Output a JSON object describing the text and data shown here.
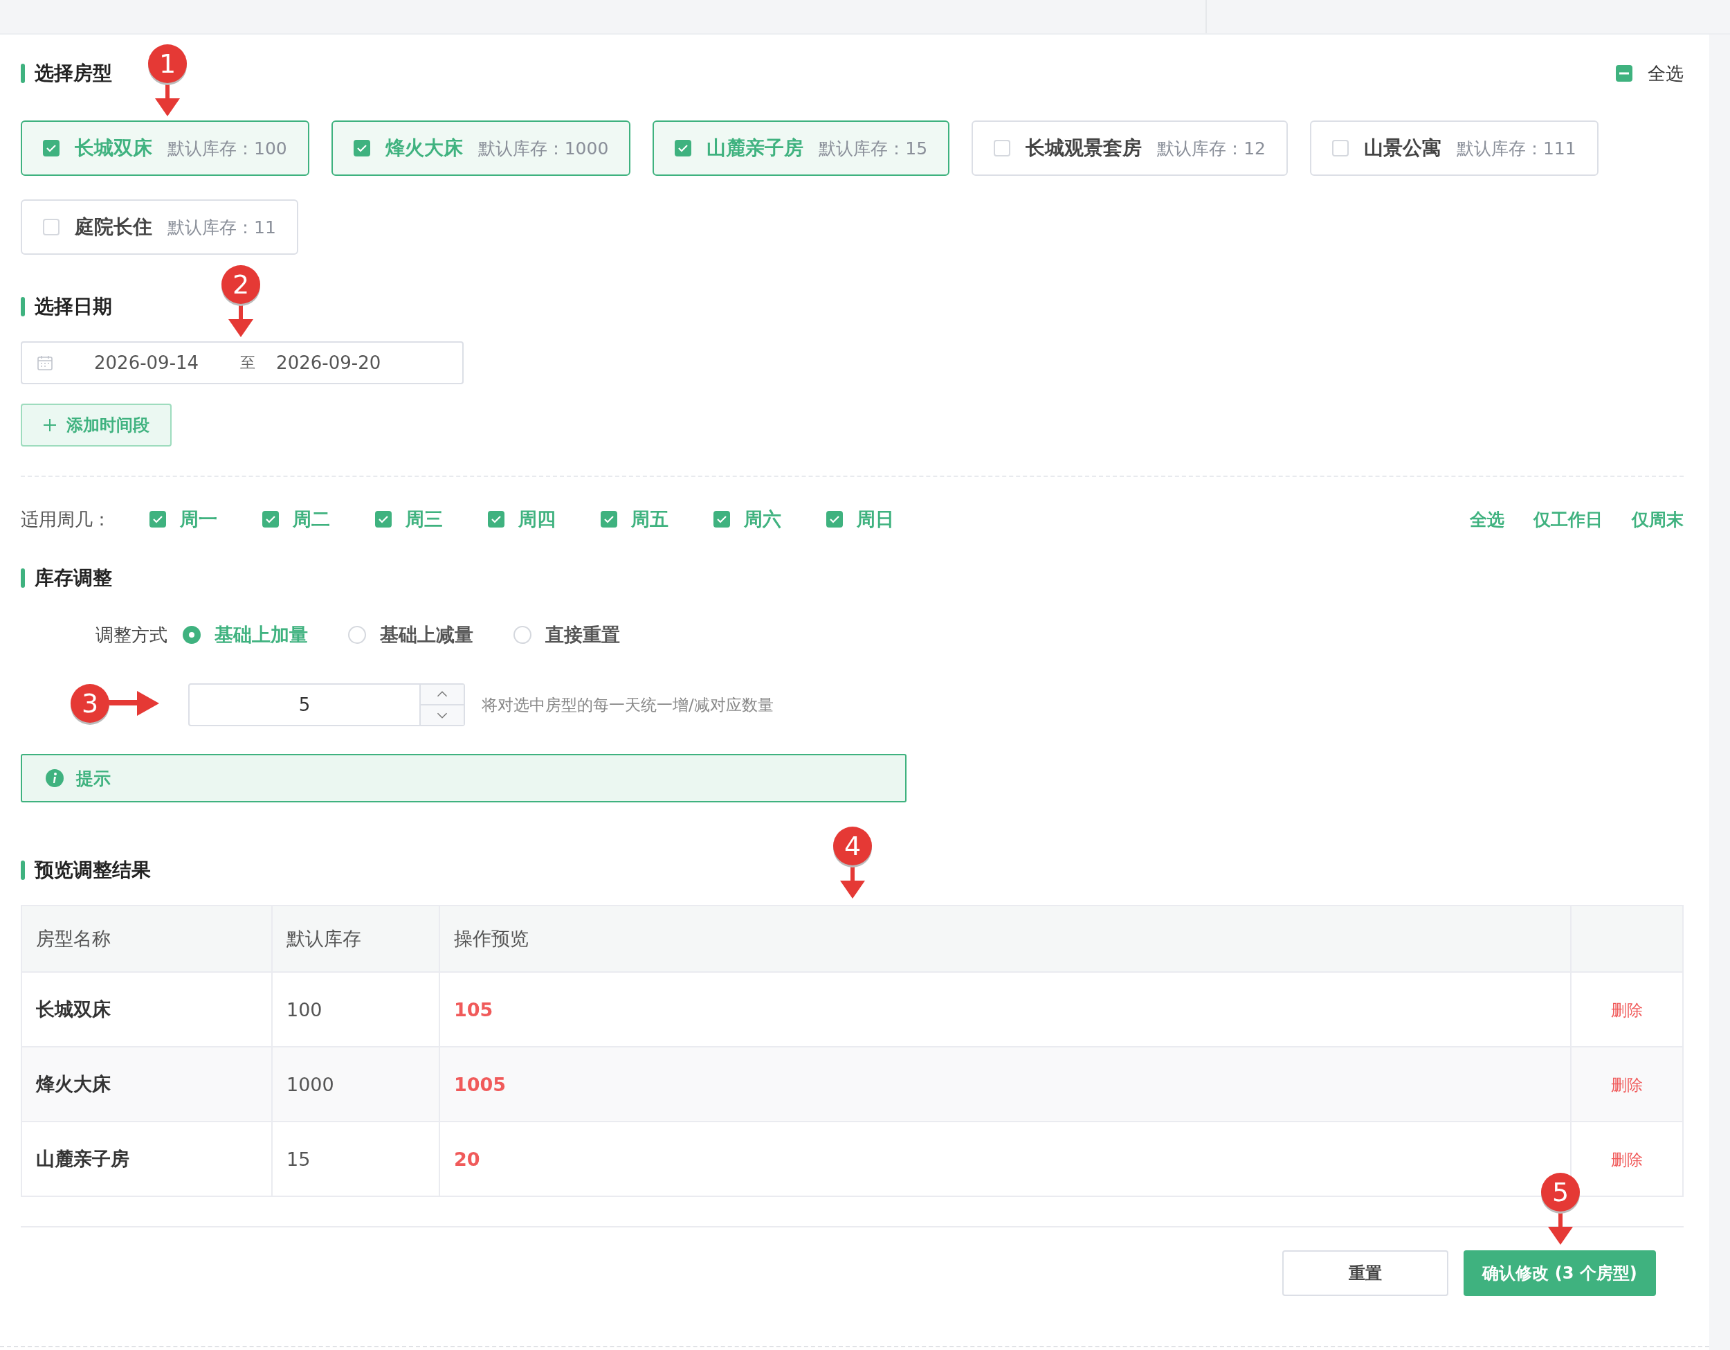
{
  "room_types": {
    "title": "选择房型",
    "select_all": {
      "label": "全选",
      "indeterminate": true
    },
    "rooms": [
      {
        "name": "长城双床",
        "stock_label": "默认库存：100",
        "checked": true
      },
      {
        "name": "烽火大床",
        "stock_label": "默认库存：1000",
        "checked": true
      },
      {
        "name": "山麓亲子房",
        "stock_label": "默认库存：15",
        "checked": true
      },
      {
        "name": "长城观景套房",
        "stock_label": "默认库存：12",
        "checked": false
      },
      {
        "name": "山景公寓",
        "stock_label": "默认库存：111",
        "checked": false
      },
      {
        "name": "庭院长住",
        "stock_label": "默认库存：11",
        "checked": false
      }
    ]
  },
  "date": {
    "title": "选择日期",
    "start": "2026-09-14",
    "separator": "至",
    "end": "2026-09-20",
    "add_button": "添加时间段"
  },
  "weekdays": {
    "label": "适用周几：",
    "days": [
      {
        "label": "周一",
        "checked": true
      },
      {
        "label": "周二",
        "checked": true
      },
      {
        "label": "周三",
        "checked": true
      },
      {
        "label": "周四",
        "checked": true
      },
      {
        "label": "周五",
        "checked": true
      },
      {
        "label": "周六",
        "checked": true
      },
      {
        "label": "周日",
        "checked": true
      }
    ],
    "shortcuts": [
      "全选",
      "仅工作日",
      "仅周末"
    ]
  },
  "adjust": {
    "title": "库存调整",
    "mode_label": "调整方式",
    "modes": [
      {
        "label": "基础上加量",
        "selected": true
      },
      {
        "label": "基础上减量",
        "selected": false
      },
      {
        "label": "直接重置",
        "selected": false
      }
    ],
    "quantity": "5",
    "hint": "将对选中房型的每一天统一增/减对应数量",
    "tip": "提示"
  },
  "preview": {
    "title": "预览调整结果",
    "columns": [
      "房型名称",
      "默认库存",
      "操作预览"
    ],
    "rows": [
      {
        "name": "长城双床",
        "stock": "100",
        "result": "105",
        "action": "删除"
      },
      {
        "name": "烽火大床",
        "stock": "1000",
        "result": "1005",
        "action": "删除"
      },
      {
        "name": "山麓亲子房",
        "stock": "15",
        "result": "20",
        "action": "删除"
      }
    ]
  },
  "buttons": {
    "reset": "重置",
    "confirm": "确认修改 (3 个房型)"
  },
  "annotations": [
    "1",
    "2",
    "3",
    "4",
    "5"
  ]
}
